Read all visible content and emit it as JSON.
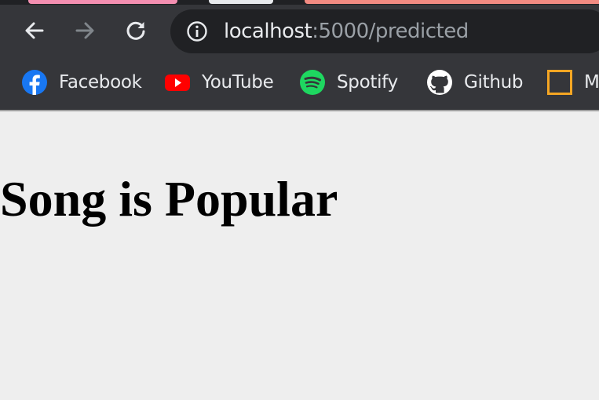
{
  "browser": {
    "address_bar": {
      "host": "localhost",
      "path": ":5000/predicted"
    },
    "bookmarks": [
      {
        "label": "Facebook",
        "icon": "facebook-icon",
        "color": "#1877f2"
      },
      {
        "label": "YouTube",
        "icon": "youtube-icon",
        "color": "#ff0000"
      },
      {
        "label": "Spotify",
        "icon": "spotify-icon",
        "color": "#1ed760"
      },
      {
        "label": "Github",
        "icon": "github-icon",
        "color": "#ffffff"
      },
      {
        "label": "M",
        "icon": "bookmark-square-icon",
        "color": "#f5a623"
      }
    ]
  },
  "page": {
    "heading": "Song is Popular"
  }
}
